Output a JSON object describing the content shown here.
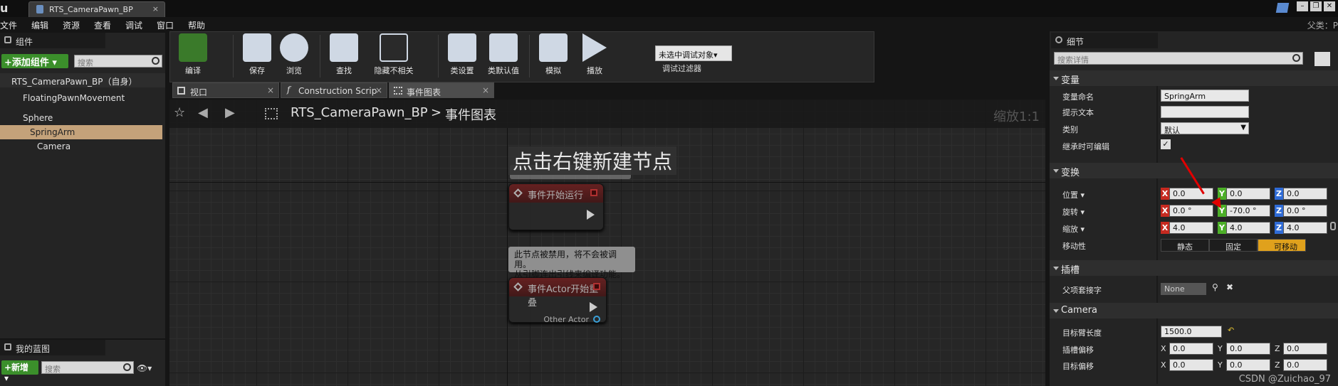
{
  "window": {
    "doc_tab": "RTS_CameraPawn_BP",
    "parent_label": "父类：P"
  },
  "menu": [
    "文件",
    "编辑",
    "资源",
    "查看",
    "调试",
    "窗口",
    "帮助"
  ],
  "components_panel": {
    "tab": "组件",
    "add_button": "+添加组件 ▾",
    "search_placeholder": "搜索",
    "self_row": "RTS_CameraPawn_BP（自身）",
    "items": [
      "FloatingPawnMovement",
      "Sphere",
      "SpringArm",
      "Camera"
    ]
  },
  "my_blueprint_panel": {
    "tab": "我的蓝图",
    "new_button": "+新增 ▾",
    "search_placeholder": "搜索"
  },
  "toolbar": {
    "compile": "编译",
    "save": "保存",
    "browse": "浏览",
    "find": "查找",
    "hide_unrelated": "隐藏不相关",
    "class_settings": "类设置",
    "class_defaults": "类默认值",
    "simulate": "模拟",
    "play": "播放",
    "debug_select": "未选中调试对象▾",
    "debug_filter": "调试过滤器"
  },
  "editor_tabs": [
    "视口",
    "Construction Scrip",
    "事件图表"
  ],
  "graph": {
    "breadcrumb_root": "RTS_CameraPawn_BP",
    "breadcrumb_sep": ">",
    "breadcrumb_current": "事件图表",
    "zoom": "缩放1:1",
    "hint": "点击右键新建节点",
    "node1_title": "事件开始运行",
    "comment2": "此节点被禁用，将不会被调用。\n从引脚连出引线来编译功能。",
    "node2_title": "事件Actor开始重叠",
    "node2_pin": "Other Actor"
  },
  "details": {
    "tab": "细节",
    "search_placeholder": "搜索详情",
    "variable_section": "变量",
    "var_name_label": "变量命名",
    "var_name_value": "SpringArm",
    "tooltip_label": "提示文本",
    "tooltip_value": "",
    "category_label": "类别",
    "category_value": "默认",
    "editable_label": "继承时可编辑",
    "editable_checked": "✓",
    "transform_section": "变换",
    "location_label": "位置 ▾",
    "location": [
      "0.0",
      "0.0",
      "0.0"
    ],
    "rotation_label": "旋转 ▾",
    "rotation": [
      "0.0 °",
      "-70.0 °",
      "0.0 °"
    ],
    "scale_label": "缩放 ▾",
    "scale": [
      "4.0",
      "4.0",
      "4.0"
    ],
    "mobility_label": "移动性",
    "mobility_options": [
      "静态",
      "固定",
      "可移动"
    ],
    "socket_section": "插槽",
    "parent_socket_label": "父项套接字",
    "parent_socket_value": "None",
    "camera_section": "Camera",
    "arm_length_label": "目标臂长度",
    "arm_length_value": "1500.0",
    "socket_offset_label": "插槽偏移",
    "socket_offset": [
      "0.0",
      "0.0",
      "0.0"
    ],
    "target_offset_label": "目标偏移",
    "target_offset": [
      "0.0",
      "0.0",
      "0.0"
    ]
  },
  "axis_letters": [
    "X",
    "Y",
    "Z"
  ],
  "watermark": "CSDN @Zuichao_97",
  "colors": {
    "axis_x": "#c62a20",
    "axis_y": "#4caf28",
    "axis_z": "#2f6bd6",
    "movable": "#e0a11c",
    "add_green": "#3b8f2b"
  }
}
